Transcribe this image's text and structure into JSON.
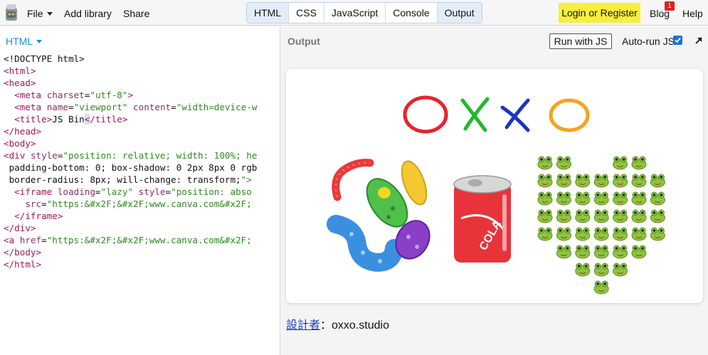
{
  "topbar": {
    "menu": {
      "file": "File",
      "add_library": "Add library",
      "share": "Share"
    },
    "tabs": [
      "HTML",
      "CSS",
      "JavaScript",
      "Console",
      "Output"
    ],
    "active_tabs": [
      "HTML",
      "Output"
    ],
    "login": "Login or Register",
    "blog": "Blog",
    "blog_badge": "1",
    "help": "Help"
  },
  "editor": {
    "label": "HTML",
    "lines": [
      "<!DOCTYPE html>",
      "<html>",
      "<head>",
      "  <meta charset=\"utf-8\">",
      "  <meta name=\"viewport\" content=\"width=device-w",
      "  <title>JS Bin</title>",
      "</head>",
      "<body>",
      "<div style=\"position: relative; width: 100%; he",
      " padding-bottom: 0; box-shadow: 0 2px 8px 0 rgb",
      " border-radius: 8px; will-change: transform;\">",
      "  <iframe loading=\"lazy\" style=\"position: abso",
      "    src=\"https:&#x2F;&#x2F;www.canva.com&#x2F;",
      "  </iframe>",
      "</div>",
      "<a href=\"https:&#x2F;&#x2F;www.canva.com&#x2F;",
      "</body>",
      "</html>"
    ]
  },
  "output": {
    "label": "Output",
    "run_button": "Run with JS",
    "autorun_label": "Auto-run JS",
    "autorun_checked": true,
    "card": {
      "title_letters": [
        "O",
        "X",
        "X",
        "O"
      ],
      "title_colors": [
        "#e8222b",
        "#1fb82c",
        "#1a34c6",
        "#f7a21c"
      ],
      "can_text": "COLA",
      "frog_icon": "frog-face-icon"
    },
    "credit": {
      "link": "設計者",
      "separator": "：",
      "name": "oxxo.studio"
    }
  },
  "colors": {
    "accent": "#1a8fd6",
    "login_bg": "#f8ee3c",
    "badge": "#e02020"
  }
}
